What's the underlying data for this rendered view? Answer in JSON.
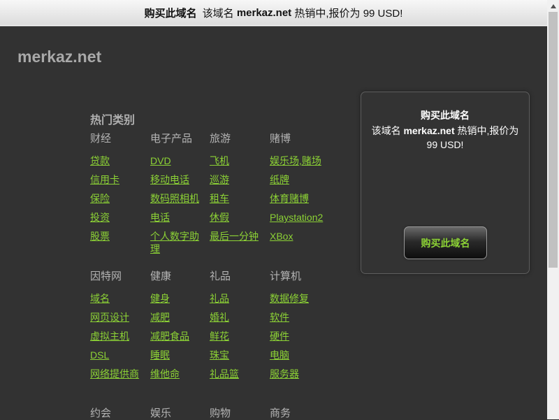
{
  "topbar": {
    "buy_label": "购买此域名",
    "text_before": "该域名",
    "domain": "merkaz.net",
    "text_after": "热销中,报价为 99 USD!"
  },
  "site": {
    "name": "merkaz.net"
  },
  "categories": {
    "heading": "热门类别",
    "columns": [
      {
        "title": "财经",
        "links": [
          "贷款",
          "信用卡",
          "保险",
          "投资",
          "股票"
        ]
      },
      {
        "title": "电子产品",
        "links": [
          "DVD",
          "移动电话",
          "数码照相机",
          "电话",
          "个人数字助理"
        ]
      },
      {
        "title": "旅游",
        "links": [
          "飞机",
          "巡游",
          "租车",
          "休假",
          "最后一分钟"
        ]
      },
      {
        "title": "赌博",
        "links": [
          "娱乐场,赌场",
          "纸牌",
          "体育赌博",
          "Playstation2",
          "XBox"
        ]
      },
      {
        "title": "因特网",
        "links": [
          "域名",
          "网页设计",
          "虚拟主机",
          "DSL",
          "网络提供商"
        ]
      },
      {
        "title": "健康",
        "links": [
          "健身",
          "减肥",
          "减肥食品",
          "睡眠",
          "维他命"
        ]
      },
      {
        "title": "礼品",
        "links": [
          "礼品",
          "婚礼",
          "鲜花",
          "珠宝",
          "礼品篮"
        ]
      },
      {
        "title": "计算机",
        "links": [
          "数据修复",
          "软件",
          "硬件",
          "电脑",
          "服务器"
        ]
      },
      {
        "title": "约会",
        "links": []
      },
      {
        "title": "娱乐",
        "links": []
      },
      {
        "title": "购物",
        "links": []
      },
      {
        "title": "商务",
        "links": []
      }
    ]
  },
  "sidebox": {
    "title": "购买此域名",
    "text_before": "该域名",
    "domain": "merkaz.net",
    "text_after": "热销中,报价为 99 USD!",
    "button_label": "购买此域名"
  },
  "colors": {
    "background": "#323232",
    "link": "#8cd235",
    "heading": "#b0b0b0"
  }
}
